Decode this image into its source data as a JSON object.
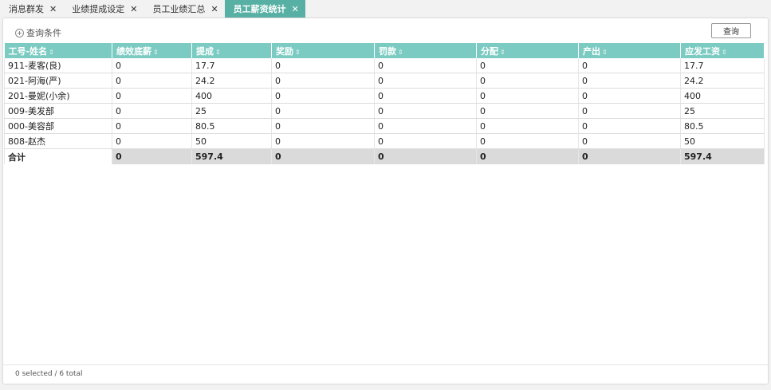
{
  "tabs": [
    {
      "label": "消息群发",
      "active": false
    },
    {
      "label": "业绩提成设定",
      "active": false
    },
    {
      "label": "员工业绩汇总",
      "active": false
    },
    {
      "label": "员工薪资统计",
      "active": true
    }
  ],
  "tab_close_glyph": "✕",
  "toolbar": {
    "query_conditions_label": "查询条件",
    "query_button_label": "查询"
  },
  "table": {
    "columns": [
      "工号-姓名",
      "绩效底薪",
      "提成",
      "奖励",
      "罚款",
      "分配",
      "产出",
      "应发工资"
    ],
    "sort_glyph": "⇕",
    "rows": [
      [
        "911-麦客(良)",
        "0",
        "17.7",
        "0",
        "0",
        "0",
        "0",
        "17.7"
      ],
      [
        "021-阿海(严)",
        "0",
        "24.2",
        "0",
        "0",
        "0",
        "0",
        "24.2"
      ],
      [
        "201-曼妮(小余)",
        "0",
        "400",
        "0",
        "0",
        "0",
        "0",
        "400"
      ],
      [
        "009-美发部",
        "0",
        "25",
        "0",
        "0",
        "0",
        "0",
        "25"
      ],
      [
        "000-美容部",
        "0",
        "80.5",
        "0",
        "0",
        "0",
        "0",
        "80.5"
      ],
      [
        "808-赵杰",
        "0",
        "50",
        "0",
        "0",
        "0",
        "0",
        "50"
      ]
    ],
    "total_row": [
      "合计",
      "0",
      "597.4",
      "0",
      "0",
      "0",
      "0",
      "597.4"
    ]
  },
  "footer": {
    "selection_status": "0 selected / 6 total"
  },
  "colors": {
    "accent": "#58b0a4",
    "header_bg": "#7ccbc2",
    "total_row_bg": "#dadada"
  }
}
